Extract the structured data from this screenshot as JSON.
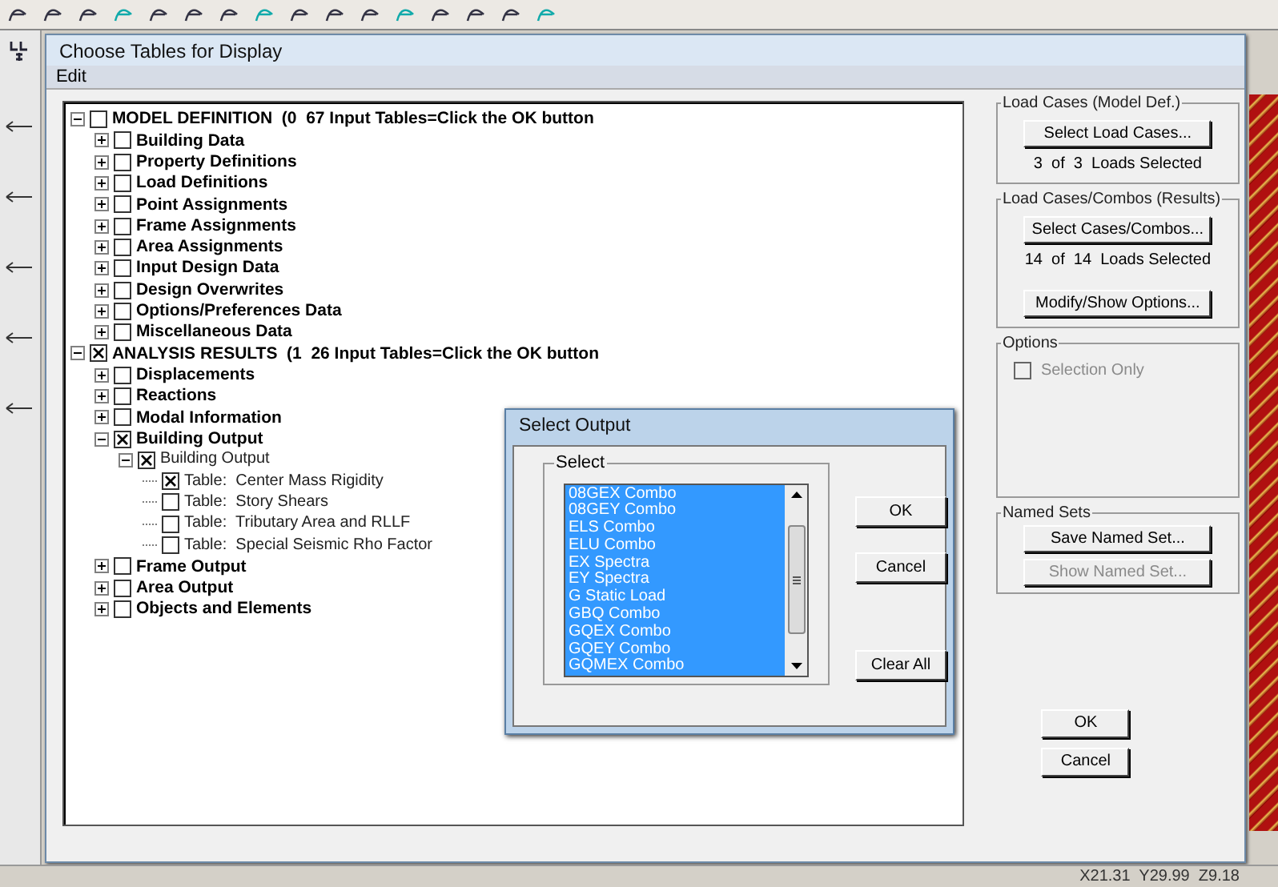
{
  "dialog": {
    "title": "Choose Tables for Display",
    "menu": [
      "Edit"
    ]
  },
  "tree": [
    {
      "label": "MODEL DEFINITION  (0  67 Input Tables=Click the OK button",
      "checked": false,
      "expanded": true,
      "children": [
        {
          "label": "Building Data",
          "checked": false,
          "expanded": false
        },
        {
          "label": "Property Definitions",
          "checked": false,
          "expanded": false
        },
        {
          "label": "Load Definitions",
          "checked": false,
          "expanded": false
        },
        {
          "label": "Point Assignments",
          "checked": false,
          "expanded": false
        },
        {
          "label": "Frame Assignments",
          "checked": false,
          "expanded": false
        },
        {
          "label": "Area Assignments",
          "checked": false,
          "expanded": false
        },
        {
          "label": "Input Design Data",
          "checked": false,
          "expanded": false
        },
        {
          "label": "Design Overwrites",
          "checked": false,
          "expanded": false
        },
        {
          "label": "Options/Preferences Data",
          "checked": false,
          "expanded": false
        },
        {
          "label": "Miscellaneous Data",
          "checked": false,
          "expanded": false
        }
      ]
    },
    {
      "label": "ANALYSIS RESULTS  (1  26 Input Tables=Click the OK button",
      "checked": true,
      "expanded": true,
      "children": [
        {
          "label": "Displacements",
          "checked": false,
          "expanded": false
        },
        {
          "label": "Reactions",
          "checked": false,
          "expanded": false
        },
        {
          "label": "Modal Information",
          "checked": false,
          "expanded": false
        },
        {
          "label": "Building Output",
          "checked": true,
          "expanded": true,
          "children": [
            {
              "label": "Building Output",
              "checked": true,
              "expanded": true,
              "children": [
                {
                  "label": "Table:  Center Mass Rigidity",
                  "checked": true
                },
                {
                  "label": "Table:  Story Shears",
                  "checked": false
                },
                {
                  "label": "Table:  Tributary Area and RLLF",
                  "checked": false
                },
                {
                  "label": "Table:  Special Seismic Rho Factor",
                  "checked": false
                }
              ]
            }
          ]
        },
        {
          "label": "Frame Output",
          "checked": false,
          "expanded": false
        },
        {
          "label": "Area Output",
          "checked": false,
          "expanded": false
        },
        {
          "label": "Objects and Elements",
          "checked": false,
          "expanded": false
        }
      ]
    }
  ],
  "load_cases_model": {
    "title": "Load Cases (Model Def.)",
    "button": "Select Load Cases...",
    "status": "3  of  3  Loads Selected"
  },
  "load_cases_results": {
    "title": "Load Cases/Combos (Results)",
    "button": "Select Cases/Combos...",
    "status": "14  of  14  Loads Selected",
    "options_button": "Modify/Show Options..."
  },
  "options": {
    "title": "Options",
    "selection_only": {
      "label": "Selection Only",
      "checked": false,
      "disabled": true
    }
  },
  "named_sets": {
    "title": "Named Sets",
    "buttons": [
      {
        "label": "Save Named Set...",
        "disabled": false
      },
      {
        "label": "Show Named Set...",
        "disabled": true
      }
    ]
  },
  "buttons": [
    "OK",
    "Cancel"
  ],
  "select_output": {
    "title": "Select Output",
    "group": "Select",
    "items": [
      {
        "label": "08GEX Combo",
        "selected": true
      },
      {
        "label": "08GEY Combo",
        "selected": true
      },
      {
        "label": "ELS Combo",
        "selected": true
      },
      {
        "label": "ELU Combo",
        "selected": true
      },
      {
        "label": "EX Spectra",
        "selected": true
      },
      {
        "label": "EY Spectra",
        "selected": true
      },
      {
        "label": "G Static Load",
        "selected": true
      },
      {
        "label": "GBQ Combo",
        "selected": true
      },
      {
        "label": "GQEX Combo",
        "selected": true
      },
      {
        "label": "GQEY Combo",
        "selected": true
      },
      {
        "label": "GQMEX Combo",
        "selected": true
      }
    ],
    "buttons": [
      "OK",
      "Cancel",
      "Clear All"
    ]
  },
  "status_bar": "X21.31  Y29.99  Z9.18"
}
